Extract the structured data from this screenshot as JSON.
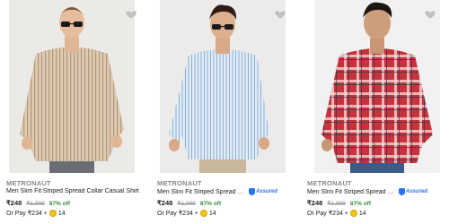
{
  "products": [
    {
      "brand": "METRONAUT",
      "title": "Men Slim Fit Striped Spread Collar Casual Shirt",
      "price": "₹248",
      "mrp": "₹1,999",
      "discount": "87% off",
      "assured": "",
      "pay_prefix": "Or Pay ₹234 +",
      "coins": "14",
      "image_desc": "beige-striped-shirt-model",
      "colors": {
        "shirt": "#d9c8b2",
        "stripe": "#b89b7c",
        "bg": "#eceae7"
      }
    },
    {
      "brand": "METRONAUT",
      "title": "Men Slim Fit Striped Spread Coll...",
      "price": "₹248",
      "mrp": "₹1,999",
      "discount": "87% off",
      "assured": "Assured",
      "pay_prefix": "Or Pay ₹234 +",
      "coins": "14",
      "image_desc": "light-blue-striped-shirt-model",
      "colors": {
        "shirt": "#dce7f2",
        "stripe": "#8fb0d4",
        "bg": "#ecebea"
      }
    },
    {
      "brand": "METRONAUT",
      "title": "Men Slim Fit Striped Spread Coll...",
      "price": "₹248",
      "mrp": "₹1,999",
      "discount": "87% off",
      "assured": "Assured",
      "pay_prefix": "Or Pay ₹234 +",
      "coins": "14",
      "image_desc": "red-checked-shirt-model",
      "colors": {
        "shirt": "#c8323a",
        "stripe": "#ffffff",
        "bg": "#f1f1f1"
      }
    }
  ]
}
